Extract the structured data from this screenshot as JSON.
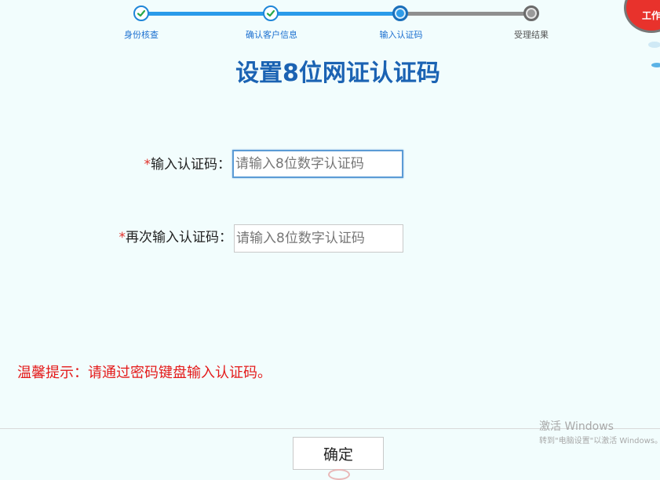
{
  "steps": [
    {
      "label": "身份核查",
      "status": "done"
    },
    {
      "label": "确认客户信息",
      "status": "done"
    },
    {
      "label": "输入认证码",
      "status": "current"
    },
    {
      "label": "受理结果",
      "status": "todo"
    }
  ],
  "badge": {
    "text": "工作"
  },
  "title": "设置8位网证认证码",
  "form": {
    "required_mark": "*",
    "code": {
      "label": "输入认证码：",
      "placeholder": "请输入8位数字认证码",
      "value": ""
    },
    "code_confirm": {
      "label": "再次输入认证码：",
      "placeholder": "请输入8位数字认证码",
      "value": ""
    }
  },
  "tip": "温馨提示：请通过密码键盘输入认证码。",
  "confirm_label": "确定",
  "watermark": {
    "line1": "激活 Windows",
    "line2": "转到\"电脑设置\"以激活 Windows。"
  },
  "colors": {
    "accent": "#2a9bea",
    "title": "#1b63b3",
    "tip": "#e41a1a",
    "background": "#f2fdfd"
  }
}
